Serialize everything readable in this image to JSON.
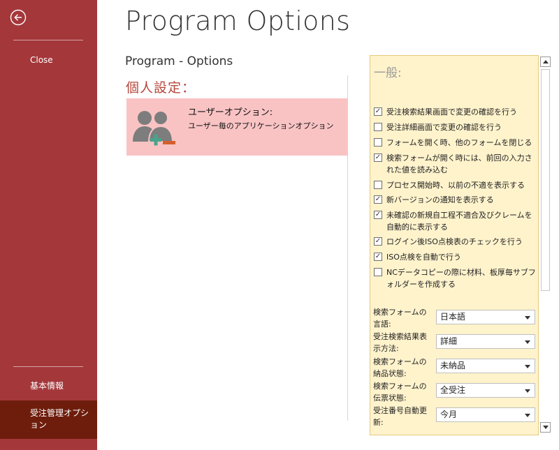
{
  "sidebar": {
    "close_label": "Close",
    "basic_info_label": "基本情報",
    "options_label": "受注管理オプション"
  },
  "header": {
    "title": "Program Options",
    "subtitle": "Program - Options"
  },
  "personal": {
    "heading": "個人設定：",
    "card": {
      "title": "ユーザーオプション:",
      "description": "ユーザー毎のアプリケーションオプション"
    }
  },
  "general": {
    "heading": "一般:",
    "checkboxes": [
      {
        "label": "受注検索結果画面で変更の確認を行う",
        "checked": true
      },
      {
        "label": "受注詳細画面で変更の確認を行う",
        "checked": false
      },
      {
        "label": "フォームを開く時、他のフォームを閉じる",
        "checked": false
      },
      {
        "label": "検索フォームが開く時には、前回の入力された値を読み込む",
        "checked": true
      },
      {
        "label": "プロセス開始時、以前の不適を表示する",
        "checked": false
      },
      {
        "label": "新バージョンの通知を表示する",
        "checked": true
      },
      {
        "label": "未確認の新規自工程不適合及びクレームを自動的に表示する",
        "checked": true
      },
      {
        "label": "ログイン後ISO点検表のチェックを行う",
        "checked": true
      },
      {
        "label": "ISO点検を自動で行う",
        "checked": true
      },
      {
        "label": "NCデータコピーの際に材料、板厚毎サブフォルダーを作成する",
        "checked": false
      }
    ],
    "selects": [
      {
        "label": "検索フォームの言語:",
        "value": "日本語"
      },
      {
        "label": "受注検索結果表示方法:",
        "value": "詳細"
      },
      {
        "label": "検索フォームの納品状態:",
        "value": "未納品"
      },
      {
        "label": "検索フォームの伝票状態:",
        "value": "全受注"
      },
      {
        "label": "受注番号自動更新:",
        "value": "今月"
      }
    ]
  },
  "colors": {
    "sidebar": "#a4373a",
    "sidebar_selected": "#6e1d0c",
    "card": "#f9c3c4",
    "panel": "#fff3cc",
    "accent_text": "#b7473c"
  }
}
